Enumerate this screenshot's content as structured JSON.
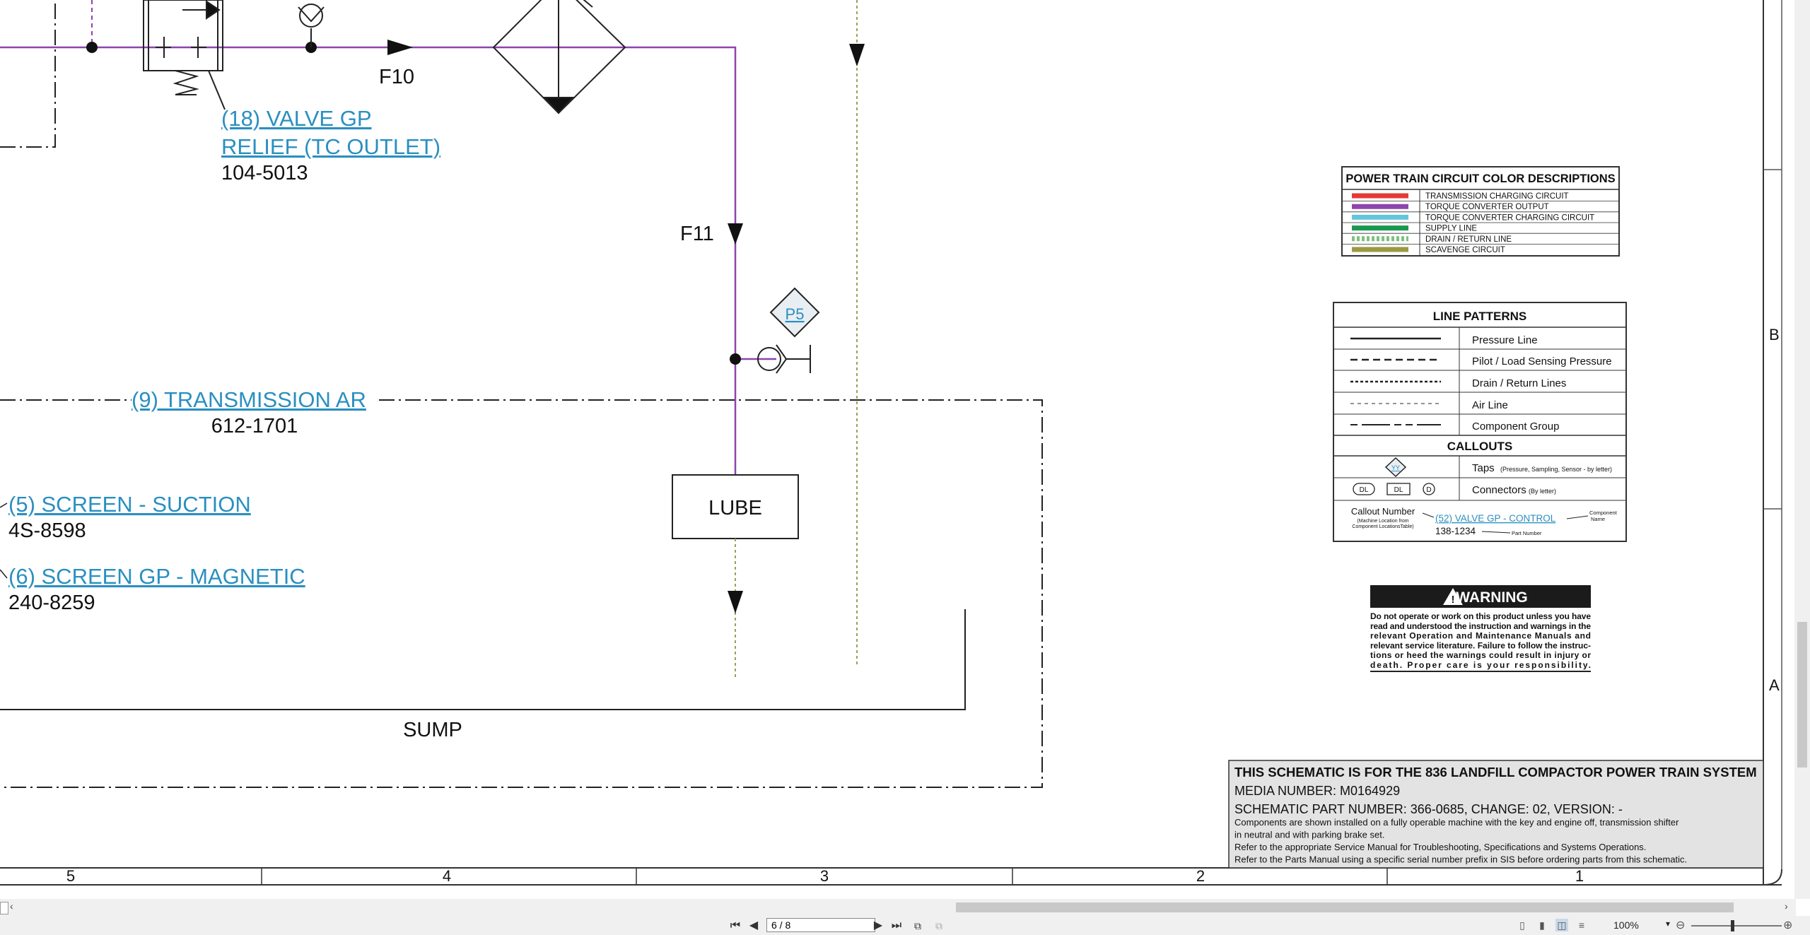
{
  "schematic": {
    "labels": {
      "f10": "F10",
      "f11": "F11",
      "lube": "LUBE",
      "sump": "SUMP",
      "p5": "P5"
    },
    "callouts": {
      "valve18_line1": "(18) VALVE GP",
      "valve18_line2": "RELIEF (TC OUTLET)",
      "valve18_part": "104-5013",
      "trans9": "(9) TRANSMISSION AR",
      "trans9_part": "612-1701",
      "screen5": "(5) SCREEN - SUCTION",
      "screen5_part": "4S-8598",
      "screen6": "(6) SCREEN GP - MAGNETIC",
      "screen6_part": "240-8259"
    },
    "color_legend": {
      "title": "POWER TRAIN CIRCUIT COLOR DESCRIPTIONS",
      "items": [
        {
          "label": "TRANSMISSION CHARGING CIRCUIT",
          "color": "#e53935"
        },
        {
          "label": "TORQUE CONVERTER OUTPUT",
          "color": "#8e44ad"
        },
        {
          "label": "TORQUE CONVERTER CHARGING CIRCUIT",
          "color": "#63c6dd"
        },
        {
          "label": "SUPPLY LINE",
          "color": "#1a9850"
        },
        {
          "label": "DRAIN / RETURN LINE",
          "color": "#7fbf7f"
        },
        {
          "label": "SCAVENGE CIRCUIT",
          "color": "#9a9a42"
        }
      ]
    },
    "line_patterns": {
      "title": "LINE PATTERNS",
      "items": [
        "Pressure Line",
        "Pilot / Load Sensing Pressure",
        "Drain / Return Lines",
        "Air Line",
        "Component Group"
      ],
      "callouts_title": "CALLOUTS",
      "taps_symbol": "YY",
      "taps_label": "Taps",
      "taps_note": "(Pressure, Sampling, Sensor - by letter)",
      "connectors_label": "Connectors",
      "connectors_note": "(By letter)",
      "connector_symbols": [
        "DL",
        "DL",
        "D"
      ],
      "callout_number": "Callout Number",
      "callout_number_note1": "(Machine Location from",
      "callout_number_note2": "Component LocationsTable)",
      "example_callout": "(52) VALVE GP - CONTROL",
      "example_part": "138-1234",
      "part_number_label": "Part Number",
      "component_label1": "Component",
      "component_label2": "Name"
    },
    "warning": {
      "title": "WARNING",
      "lines": [
        "Do not operate or work on this product unless you have",
        "read and understood the instruction and warnings in the",
        "relevant Operation and Maintenance Manuals and",
        "relevant service literature. Failure to follow the instruc-",
        "tions or heed the warnings could result in injury or",
        "death. Proper care is your responsibility."
      ]
    },
    "title_block": {
      "title": "THIS SCHEMATIC IS FOR THE 836 LANDFILL COMPACTOR POWER TRAIN SYSTEM",
      "media_number": "MEDIA NUMBER: M0164929",
      "part_number": "SCHEMATIC PART NUMBER: 366-0685, CHANGE: 02, VERSION: -",
      "notes": [
        "Components are shown installed on a fully operable machine with the key and engine off, transmission shifter",
        "in neutral and with parking brake set.",
        "Refer to the appropriate Service Manual for Troubleshooting, Specifications and Systems Operations.",
        "Refer to the Parts Manual using a specific serial number prefix in SIS before ordering parts from this schematic."
      ]
    },
    "grid": {
      "columns": [
        "5",
        "4",
        "3",
        "2",
        "1"
      ],
      "rows": [
        "B",
        "A"
      ]
    }
  },
  "viewer": {
    "page_indicator": "6 / 8",
    "zoom": "100%"
  }
}
